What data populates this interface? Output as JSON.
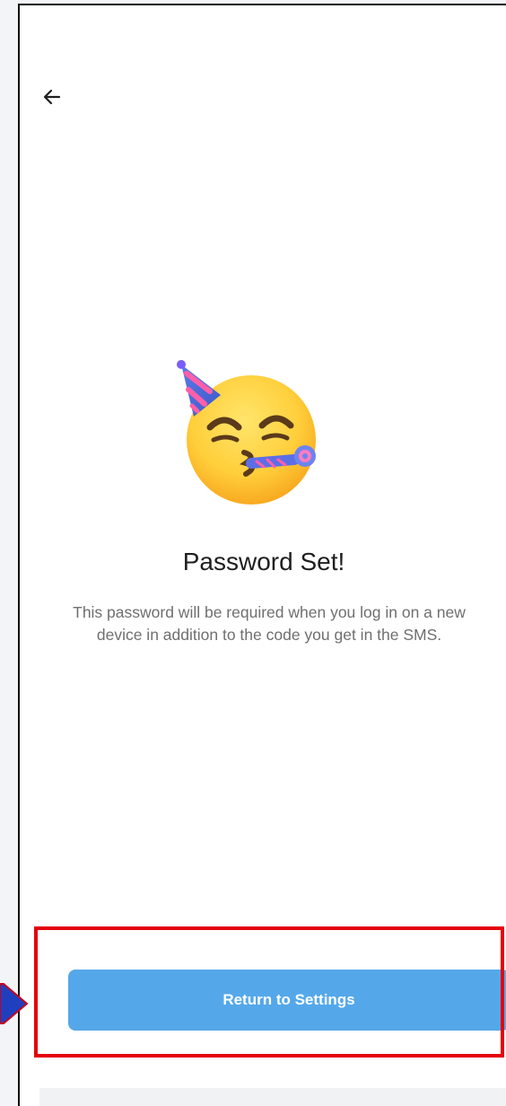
{
  "header": {
    "back_icon": "arrow-left-icon"
  },
  "hero": {
    "emoji": "party-face-emoji-icon",
    "title": "Password Set!",
    "description": "This password will be required when you log in on a new device in addition to the code you get in the SMS."
  },
  "footer": {
    "button_label": "Return to Settings",
    "button_color": "#54a8ea"
  },
  "annotations": {
    "highlight_color": "#e3000b",
    "pointer_color": "#1f3fbf"
  }
}
